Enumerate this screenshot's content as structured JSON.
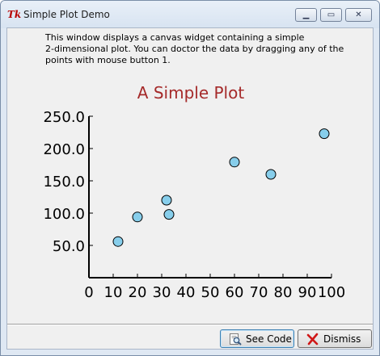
{
  "window": {
    "title": "Simple Plot Demo",
    "app_icon": "tk-feather-icon",
    "app_icon_text": "Tk"
  },
  "message": "This window displays a canvas widget containing a simple\n2-dimensional plot.  You can doctor the data by dragging any of the\npoints with mouse button 1.",
  "chart_data": {
    "type": "scatter",
    "title": "A Simple Plot",
    "xlabel": "",
    "ylabel": "",
    "xlim": [
      0,
      100
    ],
    "ylim": [
      0,
      250
    ],
    "x_ticks": [
      "0",
      "10",
      "20",
      "30",
      "40",
      "50",
      "60",
      "70",
      "80",
      "90",
      "100"
    ],
    "y_ticks": [
      "50.0",
      "100.0",
      "150.0",
      "200.0",
      "250.0"
    ],
    "points": [
      {
        "x": 12,
        "y": 56
      },
      {
        "x": 20,
        "y": 94
      },
      {
        "x": 33,
        "y": 98
      },
      {
        "x": 32,
        "y": 120
      },
      {
        "x": 60,
        "y": 179
      },
      {
        "x": 75,
        "y": 160
      },
      {
        "x": 97,
        "y": 223
      }
    ],
    "title_color": "#a52a2a",
    "point_color": "#87ceeb",
    "grid": false
  },
  "buttons": {
    "see_code": "See Code",
    "dismiss": "Dismiss"
  }
}
